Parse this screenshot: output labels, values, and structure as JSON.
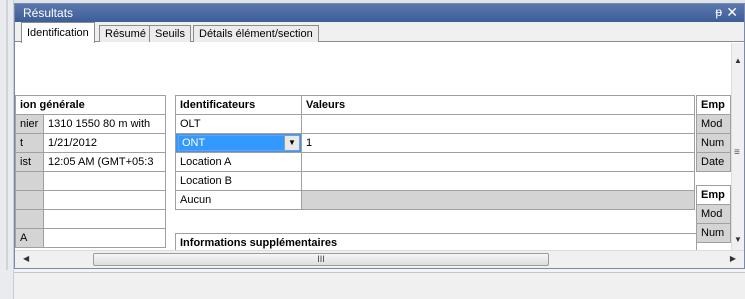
{
  "panel": {
    "title": "Résultats",
    "pin_glyph": "ᵽ",
    "close_glyph": "✕"
  },
  "tabs": [
    {
      "label": "Identification",
      "active": true
    },
    {
      "label": "Résumé",
      "active": false
    },
    {
      "label": "Seuils",
      "active": false
    },
    {
      "label": "Détails élément/section",
      "active": false
    }
  ],
  "general_table": {
    "header": "ion générale",
    "rows": [
      {
        "key": "nier",
        "value": "1310 1550 80 m with"
      },
      {
        "key": "t",
        "value": "1/21/2012"
      },
      {
        "key": "ist",
        "value": "12:05 AM (GMT+05:3"
      },
      {
        "key": "",
        "value": ""
      },
      {
        "key": "",
        "value": ""
      },
      {
        "key": "",
        "value": ""
      },
      {
        "key": "A",
        "value": ""
      }
    ]
  },
  "identifiers_table": {
    "header_identifiers": "Identificateurs",
    "header_values": "Valeurs",
    "rows": [
      {
        "identifier": "OLT",
        "value": ""
      },
      {
        "identifier": "ONT",
        "value": "1",
        "dropdown": true
      },
      {
        "identifier": "Location A",
        "value": ""
      },
      {
        "identifier": "Location B",
        "value": ""
      },
      {
        "identifier": "Aucun",
        "value": "",
        "gray": true
      }
    ]
  },
  "emp_table_1": {
    "header": "Emp",
    "rows": [
      "Mod",
      "Num",
      "Date"
    ]
  },
  "emp_table_2": {
    "header": "Emp",
    "rows": [
      "Mod",
      "Num"
    ]
  },
  "additional_info": {
    "header": "Informations supplémentaires"
  },
  "scrollbars": {
    "thumb_grip": "III",
    "up": "▲",
    "down": "▼",
    "left": "◀",
    "right": "▶",
    "mid_grip": "≡"
  }
}
